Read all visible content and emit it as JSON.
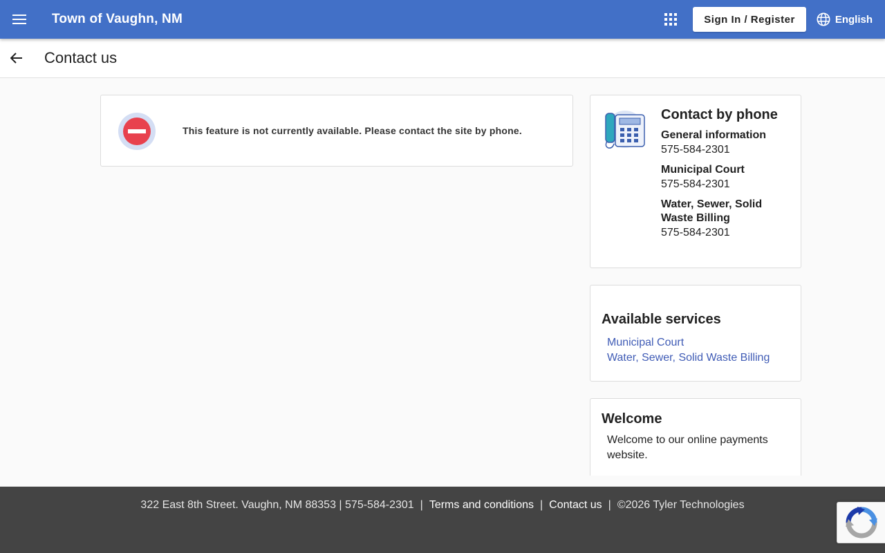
{
  "header": {
    "site_title": "Town of Vaughn, NM",
    "signin_label": "Sign In / Register",
    "language_label": "English",
    "menu_icon": "hamburger-menu-icon",
    "apps_icon": "apps-grid-icon",
    "language_icon": "globe-icon",
    "brand_color": "#4270c7"
  },
  "subheader": {
    "title": "Contact us",
    "back_icon": "arrow-left-icon"
  },
  "notice": {
    "message": "This feature is not currently available. Please contact the site by phone.",
    "icon": "no-entry-icon"
  },
  "phone": {
    "heading": "Contact by phone",
    "icon": "telephone-icon",
    "contacts": [
      {
        "label": "General information",
        "number": "575-584-2301"
      },
      {
        "label": "Municipal Court",
        "number": "575-584-2301"
      },
      {
        "label": "Water, Sewer, Solid Waste Billing",
        "number": "575-584-2301"
      }
    ]
  },
  "services": {
    "heading": "Available services",
    "items": [
      {
        "label": "Municipal Court"
      },
      {
        "label": "Water, Sewer, Solid Waste Billing"
      }
    ],
    "link_color": "#3f5bb5"
  },
  "welcome": {
    "heading": "Welcome",
    "text": "Welcome to our online payments website."
  },
  "footer": {
    "address": "322 East 8th Street. Vaughn, NM 88353 | 575-584-2301",
    "terms_label": "Terms and conditions",
    "contact_label": "Contact us",
    "copyright": "©2026 Tyler Technologies",
    "separator": "|"
  },
  "recaptcha": {
    "icon": "recaptcha-icon"
  }
}
